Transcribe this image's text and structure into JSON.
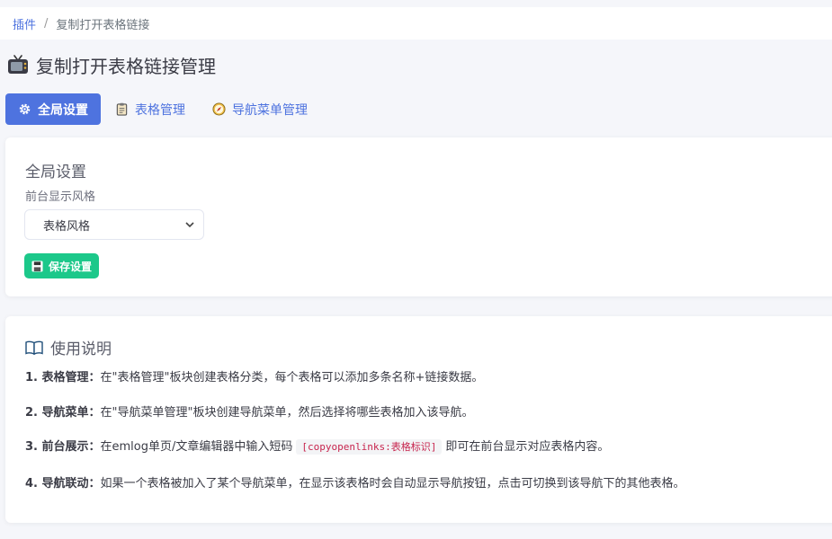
{
  "breadcrumb": {
    "root": "插件",
    "separator": "/",
    "current": "复制打开表格链接"
  },
  "page": {
    "title": "复制打开表格链接管理",
    "icon": "tv-icon"
  },
  "tabs": [
    {
      "label": "全局设置",
      "icon": "gear-icon",
      "active": true
    },
    {
      "label": "表格管理",
      "icon": "clipboard-icon",
      "active": false
    },
    {
      "label": "导航菜单管理",
      "icon": "compass-icon",
      "active": false
    }
  ],
  "settings": {
    "title": "全局设置",
    "style_label": "前台显示风格",
    "style_value": "表格风格",
    "save_label": "保存设置"
  },
  "usage": {
    "title": "使用说明",
    "items": [
      {
        "heading": "1. 表格管理：",
        "text": "在\"表格管理\"板块创建表格分类，每个表格可以添加多条名称+链接数据。"
      },
      {
        "heading": "2. 导航菜单：",
        "text": "在\"导航菜单管理\"板块创建导航菜单，然后选择将哪些表格加入该导航。"
      },
      {
        "heading": "3. 前台展示：",
        "text_before": "在emlog单页/文章编辑器中输入短码",
        "code": "[copyopenlinks:表格标识]",
        "text_after": "即可在前台显示对应表格内容。"
      },
      {
        "heading": "4. 导航联动：",
        "text": "如果一个表格被加入了某个导航菜单，在显示该表格时会自动显示导航按钮，点击可切换到该导航下的其他表格。"
      }
    ]
  },
  "colors": {
    "primary": "#4e73df",
    "success": "#1cc88a",
    "code": "#c7254e"
  }
}
